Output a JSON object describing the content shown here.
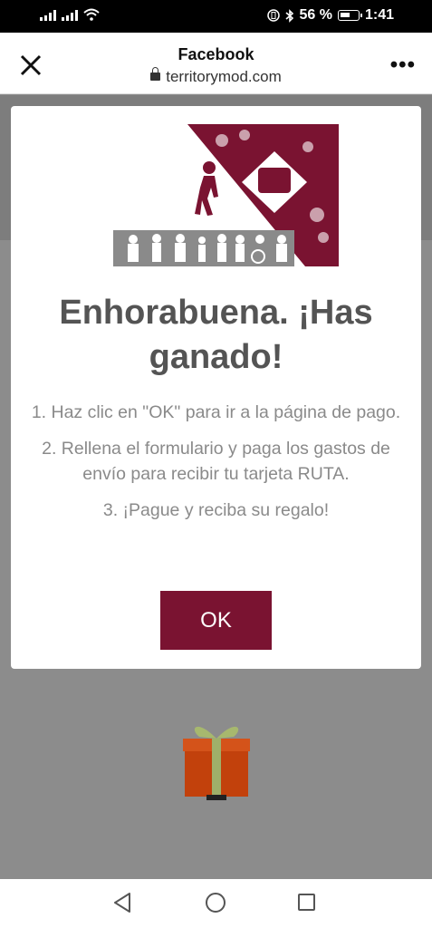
{
  "status_bar": {
    "battery_percent": "56 %",
    "time": "1:41"
  },
  "header": {
    "title": "Facebook",
    "url": "territorymod.com",
    "close_icon": "close-icon",
    "menu_icon": "more-dots-icon",
    "menu_label": "•••"
  },
  "modal": {
    "title": "Enhorabuena. ¡Has ganado!",
    "steps": [
      "1. Haz clic en \"OK\" para ir a la página de pago.",
      "2. Rellena el formulario y paga los gastos de envío para recibir tu tarjeta RUTA.",
      "3. ¡Pague y reciba su regalo!"
    ],
    "ok_label": "OK",
    "accent_color": "#7a1331"
  },
  "navbar": {
    "icons": [
      "back-icon",
      "home-icon",
      "recent-apps-icon"
    ]
  }
}
